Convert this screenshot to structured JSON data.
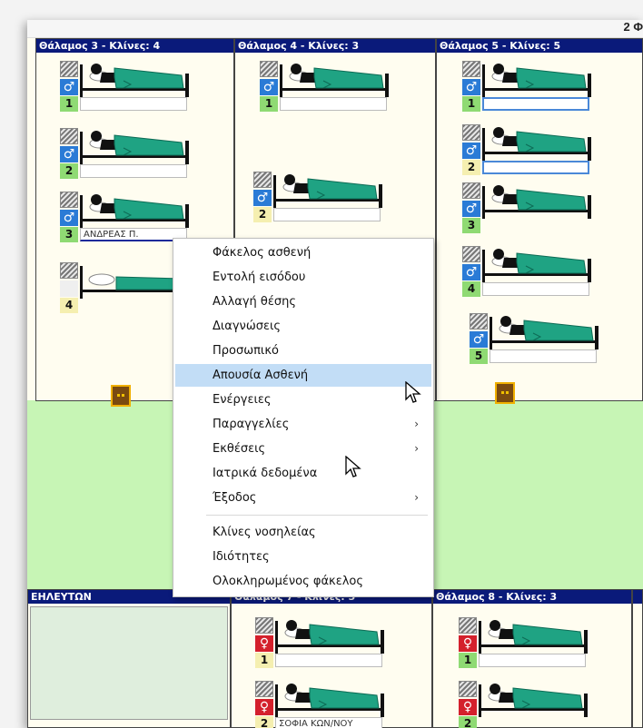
{
  "topbar": {
    "partial_text": "2 Φ"
  },
  "rooms": {
    "room3": {
      "header": "Θάλαμος 3 - Κλίνες: 4"
    },
    "room4": {
      "header": "Θάλαμος 4 - Κλίνες: 3"
    },
    "room5": {
      "header": "Θάλαμος 5 - Κλίνες: 5"
    },
    "nurse": {
      "header": "ΕΗΛΕΥΤΩΝ"
    },
    "room7": {
      "header": "Θάλαμος 7 - Κλίνες: 5"
    },
    "room8": {
      "header": "Θάλαμος 8 - Κλίνες: 3"
    }
  },
  "beds": {
    "r3b1": {
      "num": "1",
      "gender": "♂",
      "label": ""
    },
    "r3b2": {
      "num": "2",
      "gender": "♂",
      "label": ""
    },
    "r3b3": {
      "num": "3",
      "gender": "♂",
      "label": "ΑΝΔΡΕΑΣ Π."
    },
    "r3b4": {
      "num": "4",
      "gender": "",
      "label": ""
    },
    "r4b1": {
      "num": "1",
      "gender": "♂",
      "label": ""
    },
    "r4b2": {
      "num": "2",
      "gender": "♂",
      "label": ""
    },
    "r5b1": {
      "num": "1",
      "gender": "♂",
      "label": ""
    },
    "r5b2": {
      "num": "2",
      "gender": "♂",
      "label": ""
    },
    "r5b3": {
      "num": "3",
      "gender": "♂",
      "label": ""
    },
    "r5b4": {
      "num": "4",
      "gender": "♂",
      "label": ""
    },
    "r5b5": {
      "num": "5",
      "gender": "♂",
      "label": ""
    },
    "r7b1": {
      "num": "1",
      "gender": "♀",
      "label": ""
    },
    "r7b2": {
      "num": "2",
      "gender": "♀",
      "label": "ΣΟΦΙΑ ΚΩΝ/ΝΟΥ"
    },
    "r8b1": {
      "num": "1",
      "gender": "♀",
      "label": ""
    },
    "r8b2": {
      "num": "2",
      "gender": "♀",
      "label": ""
    }
  },
  "context_menu": {
    "items": [
      {
        "label": "Φάκελος ασθενή",
        "submenu": false
      },
      {
        "label": "Εντολή εισόδου",
        "submenu": false
      },
      {
        "label": "Αλλαγή θέσης",
        "submenu": false
      },
      {
        "label": "Διαγνώσεις",
        "submenu": false
      },
      {
        "label": "Προσωπικό",
        "submenu": false
      },
      {
        "label": "Απουσία Ασθενή",
        "submenu": false,
        "highlighted": true
      },
      {
        "label": "Ενέργειες",
        "submenu": false
      },
      {
        "label": "Παραγγελίες",
        "submenu": true
      },
      {
        "label": "Εκθέσεις",
        "submenu": true
      },
      {
        "label": "Ιατρικά δεδομένα",
        "submenu": false
      },
      {
        "label": "Έξοδος",
        "submenu": true
      },
      {
        "label": "Κλίνες νοσηλείας",
        "submenu": false
      },
      {
        "label": "Ιδιότητες",
        "submenu": false
      },
      {
        "label": "Ολοκληρωμένος φάκελος",
        "submenu": false
      }
    ],
    "submenu_arrow": "›"
  },
  "colors": {
    "room_header": "#0a1a7a",
    "corridor": "#c7f5b5",
    "male": "#2a7bd6",
    "female": "#d4202c",
    "blanket": "#1fa383",
    "menu_highlight": "#c2ddf6"
  }
}
